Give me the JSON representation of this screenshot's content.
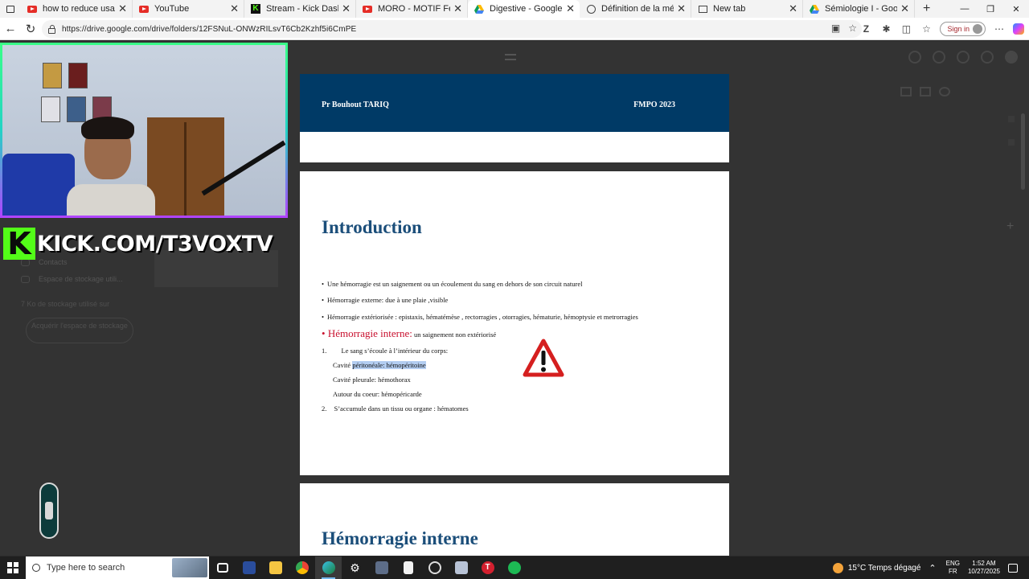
{
  "browser": {
    "tabs": [
      {
        "title": "how to reduce usage of app",
        "icon": "youtube-icon"
      },
      {
        "title": "YouTube",
        "icon": "youtube-icon"
      },
      {
        "title": "Stream - Kick Dashboard",
        "icon": "kick-icon"
      },
      {
        "title": "MORO - MOTIF Feat GNAWA",
        "icon": "youtube-icon"
      },
      {
        "title": "Digestive - Google Drive",
        "icon": "google-drive-icon",
        "active": true
      },
      {
        "title": "Définition de la métrorragie",
        "icon": "globe-icon"
      },
      {
        "title": "New tab",
        "icon": "new-tab-icon"
      },
      {
        "title": "Sémiologie I - Google Drive",
        "icon": "google-drive-icon"
      }
    ],
    "url": "https://drive.google.com/drive/folders/12FSNuL-ONWzRILsvT6Cb2Kzhf5i6CmPE",
    "signin_label": "Sign in"
  },
  "document": {
    "page1": {
      "author": "Pr Bouhout TARIQ",
      "header_right": "FMPO 2023"
    },
    "page2": {
      "heading": "Introduction",
      "line1": "Une hémorragie est un saignement ou un écoulement du sang en dehors de son circuit naturel",
      "line2": "Hémorragie externe: due à une plaie ,visible",
      "line3": "Hémorragie extériorisée : epistaxis, hématémèse , rectorragies , otorragies, hématurie, hémoptysie et metrorragies",
      "line4_red": "Hémorragie interne:",
      "line4_rest": " un saignement non extériorisé",
      "num1": "1.",
      "item1": "Le sang s’écoule à l’intérieur du corps:",
      "cav1_prefix": "Cavité ",
      "cav1_highlight": "péritonéale: hémopéritoine",
      "cav2": "Cavité pleurale: hémothorax",
      "cav3": "Autour du coeur: hémopéricarde",
      "num2": "2.",
      "item2": "S’accumule dans un tissu ou organe : hématomes"
    },
    "page3": {
      "heading": "Hémorragie interne"
    }
  },
  "drive_sidebar_dim": {
    "item_contacts": "Contacts",
    "item_storage": "Espace de stockage utili...",
    "storage_usage": "7 Ko de stockage utilisé sur",
    "get_more_storage": "Acquérir l'espace de stockage"
  },
  "overlay": {
    "kick_text": "KICK.COM/T3VOXTV"
  },
  "taskbar": {
    "search_placeholder": "Type here to search",
    "weather": "15°C  Temps dégagé",
    "lang_top": "ENG",
    "lang_bottom": "FR",
    "time": "1:52 AM",
    "date": "10/27/2025"
  },
  "colors": {
    "header_band": "#003a66",
    "heading_blue": "#1b4e7a",
    "red_text": "#c8102e",
    "kick_green": "#53fc18",
    "selection": "#b3cdf1"
  }
}
